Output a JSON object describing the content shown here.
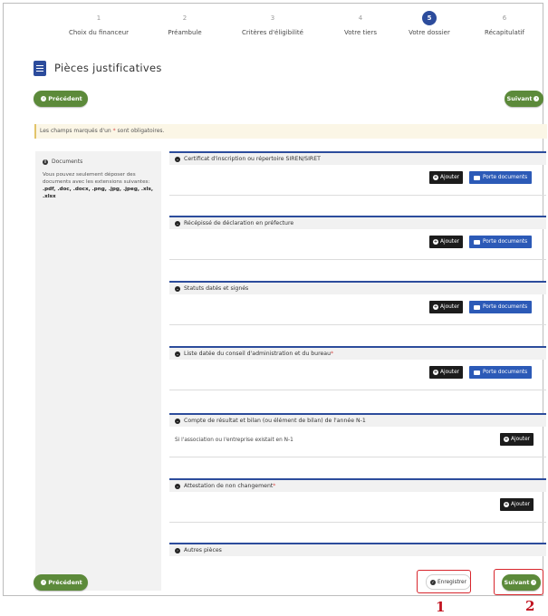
{
  "stepper": {
    "steps": [
      {
        "num": "1",
        "label": "Choix du financeur"
      },
      {
        "num": "2",
        "label": "Préambule"
      },
      {
        "num": "3",
        "label": "Critères d'éligibilité"
      },
      {
        "num": "4",
        "label": "Votre tiers"
      },
      {
        "num": "5",
        "label": "Votre dossier"
      },
      {
        "num": "6",
        "label": "Récapitulatif"
      }
    ],
    "active_step": "5",
    "active_color": "#2c4c9c"
  },
  "page": {
    "title": "Pièces justificatives",
    "title_icon": "document-icon"
  },
  "nav": {
    "prev_label": "Précédent",
    "next_label": "Suivant",
    "save_label": "Enregistrer",
    "prev_icon": "circle-arrow-left-icon",
    "next_icon": "circle-arrow-right-icon",
    "save_icon": "circle-check-icon",
    "green": "#5c8a3a"
  },
  "banner": {
    "text_before": "Les champs marqués d'un ",
    "star": "*",
    "text_after": " sont obligatoires."
  },
  "sidebar": {
    "heading": "Documents",
    "text": "Vous pouvez seulement déposer des documents avec les extensions suivantes:",
    "extensions": ".pdf, .doc, .docx, .png, .jpg, .jpeg, .xls, .xlsx"
  },
  "buttons": {
    "add_label": "Ajouter",
    "portfolio_label": "Porte documents",
    "portfolio_color": "#2c5ab7"
  },
  "sections": [
    {
      "title": "Certificat d'inscription ou répertoire SIREN/SIRET",
      "required": false
    },
    {
      "title": "Récépissé de déclaration en préfecture",
      "required": false
    },
    {
      "title": "Statuts datés et signés",
      "required": false
    },
    {
      "title": "Liste datée du conseil d'administration et du bureau",
      "required": true
    },
    {
      "title": "Compte de résultat et bilan (ou élément de bilan) de l'année N-1",
      "required": false,
      "note": "Si l'association ou l'entreprise existait en N-1"
    },
    {
      "title": "Attestation de non changement",
      "required": true
    },
    {
      "title": "Autres pièces",
      "required": false
    }
  ],
  "annotations": [
    "1",
    "2"
  ]
}
